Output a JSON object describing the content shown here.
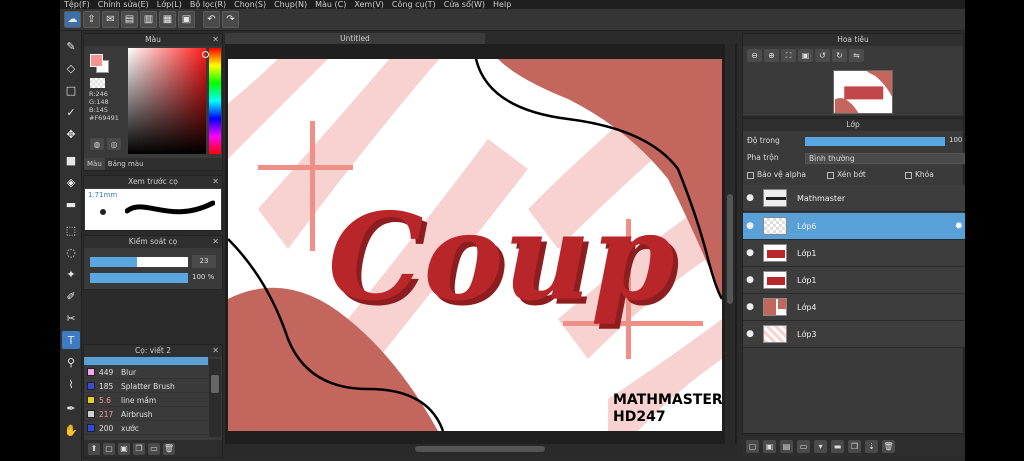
{
  "menu": [
    "Tệp(F)",
    "Chỉnh sửa(E)",
    "Lớp(L)",
    "Bộ lọc(R)",
    "Chọn(S)",
    "Chụp(N)",
    "Màu (C)",
    "Xem(V)",
    "Công cụ(T)",
    "Cửa sổ(W)",
    "Help"
  ],
  "document": {
    "title": "Untitled"
  },
  "color_panel": {
    "title": "Màu",
    "r": "R:246",
    "g": "G:148",
    "b": "B:145",
    "hex": "#F69491",
    "tabs": [
      "Màu",
      "Bảng màu"
    ],
    "foreground": "#f69491"
  },
  "preview_panel": {
    "title": "Xem trước cọ",
    "size": "1.71mm"
  },
  "brush_control": {
    "title": "Kiểm soát cọ",
    "size_value": "23",
    "opacity_value": "100 %",
    "size_fraction": 0.48,
    "opacity_fraction": 1.0
  },
  "brush_list": {
    "title": "Cọ: viết 2",
    "items": [
      {
        "num": "449",
        "name": "Blur",
        "color": "#f7a6f2"
      },
      {
        "num": "185",
        "name": "Splatter Brush",
        "color": "#3a49d8"
      },
      {
        "num": "5.6",
        "name": "line mầm",
        "color": "#e6d21a"
      },
      {
        "num": "217",
        "name": "Airbrush",
        "color": "#cfcfcf"
      },
      {
        "num": "200",
        "name": "xước",
        "color": "#2f4be0"
      }
    ]
  },
  "navigator": {
    "title": "Hoa tiêu"
  },
  "layers_panel": {
    "title": "Lớp",
    "opacity_label": "Độ trong",
    "opacity_value": "100",
    "blend_label": "Pha trộn",
    "blend_value": "Bình thường",
    "protect_alpha": "Bảo vệ alpha",
    "clipping": "Xén bớt",
    "lock": "Khóa",
    "layers": [
      {
        "name": "Mathmaster",
        "selected": false
      },
      {
        "name": "Lớp6",
        "selected": true
      },
      {
        "name": "Lớp1",
        "selected": false
      },
      {
        "name": "Lớp1",
        "selected": false
      },
      {
        "name": "Lớp4",
        "selected": false
      },
      {
        "name": "Lớp3",
        "selected": false
      }
    ]
  },
  "artwork": {
    "main_text": "Coup",
    "watermark_line1": "MATHMASTER",
    "watermark_line2": "HD247",
    "colors": {
      "dusty_red": "#c3665e",
      "pink_stripe": "#f8d2d0",
      "cross": "#ef8f86",
      "text_red": "#b9262a"
    }
  }
}
